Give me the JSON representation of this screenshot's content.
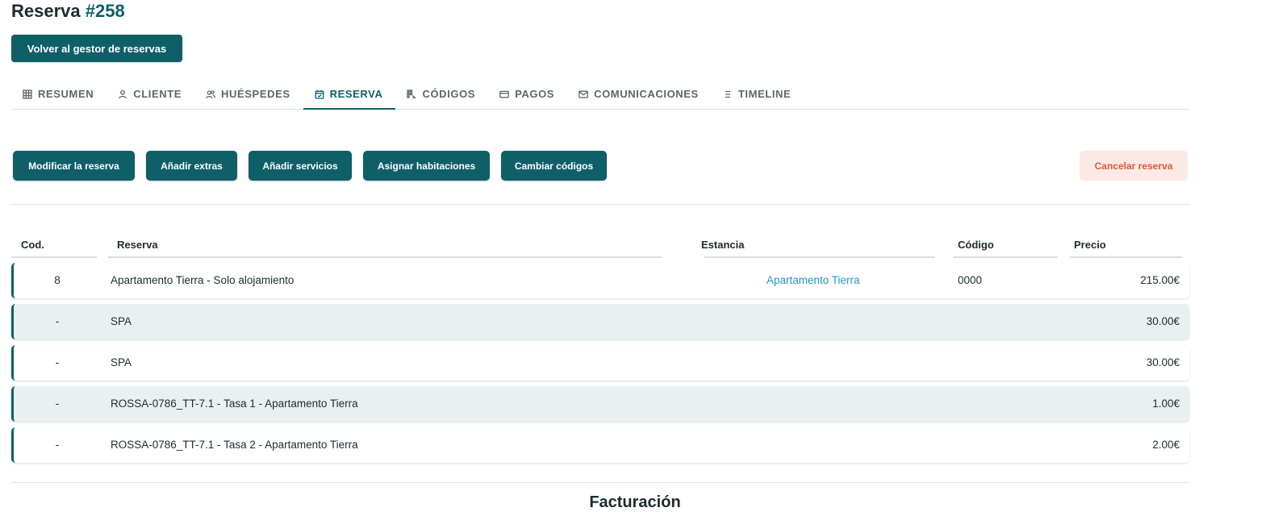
{
  "header": {
    "title_prefix": "Reserva",
    "title_number": "#258",
    "back_button": "Volver al gestor de reservas"
  },
  "tabs": [
    {
      "label": "RESUMEN",
      "icon": "grid-icon"
    },
    {
      "label": "CLIENTE",
      "icon": "user-icon"
    },
    {
      "label": "HUÉSPEDES",
      "icon": "users-icon"
    },
    {
      "label": "RESERVA",
      "icon": "calendar-icon",
      "active": true
    },
    {
      "label": "CÓDIGOS",
      "icon": "codes-icon"
    },
    {
      "label": "PAGOS",
      "icon": "card-icon"
    },
    {
      "label": "COMUNICACIONES",
      "icon": "mail-icon"
    },
    {
      "label": "TIMELINE",
      "icon": "list-icon"
    }
  ],
  "actions": {
    "modify": "Modificar la reserva",
    "extras": "Añadir extras",
    "services": "Añadir servicios",
    "rooms": "Asignar habitaciones",
    "codes": "Cambiar códigos",
    "cancel": "Cancelar reserva"
  },
  "table": {
    "headers": [
      "Cod.",
      "Reserva",
      "Estancia",
      "Código",
      "Precio"
    ],
    "rows": [
      {
        "cod": "8",
        "reserva": "Apartamento Tierra - Solo alojamiento",
        "estancia": "Apartamento Tierra",
        "codigo": "0000",
        "precio": "215.00€"
      },
      {
        "cod": "-",
        "reserva": "SPA",
        "estancia": "",
        "codigo": "",
        "precio": "30.00€"
      },
      {
        "cod": "-",
        "reserva": "SPA",
        "estancia": "",
        "codigo": "",
        "precio": "30.00€"
      },
      {
        "cod": "-",
        "reserva": "ROSSA-0786_TT-7.1 - Tasa 1 - Apartamento Tierra",
        "estancia": "",
        "codigo": "",
        "precio": "1.00€"
      },
      {
        "cod": "-",
        "reserva": "ROSSA-0786_TT-7.1 - Tasa 2 - Apartamento Tierra",
        "estancia": "",
        "codigo": "",
        "precio": "2.00€"
      }
    ]
  },
  "footer": {
    "heading": "Facturación"
  },
  "colors": {
    "primary": "#0e5f68",
    "link": "#1f98c0",
    "cancel_bg": "#fbe9e4",
    "cancel_text": "#e0583a",
    "row_alt": "#eaf0f0"
  }
}
